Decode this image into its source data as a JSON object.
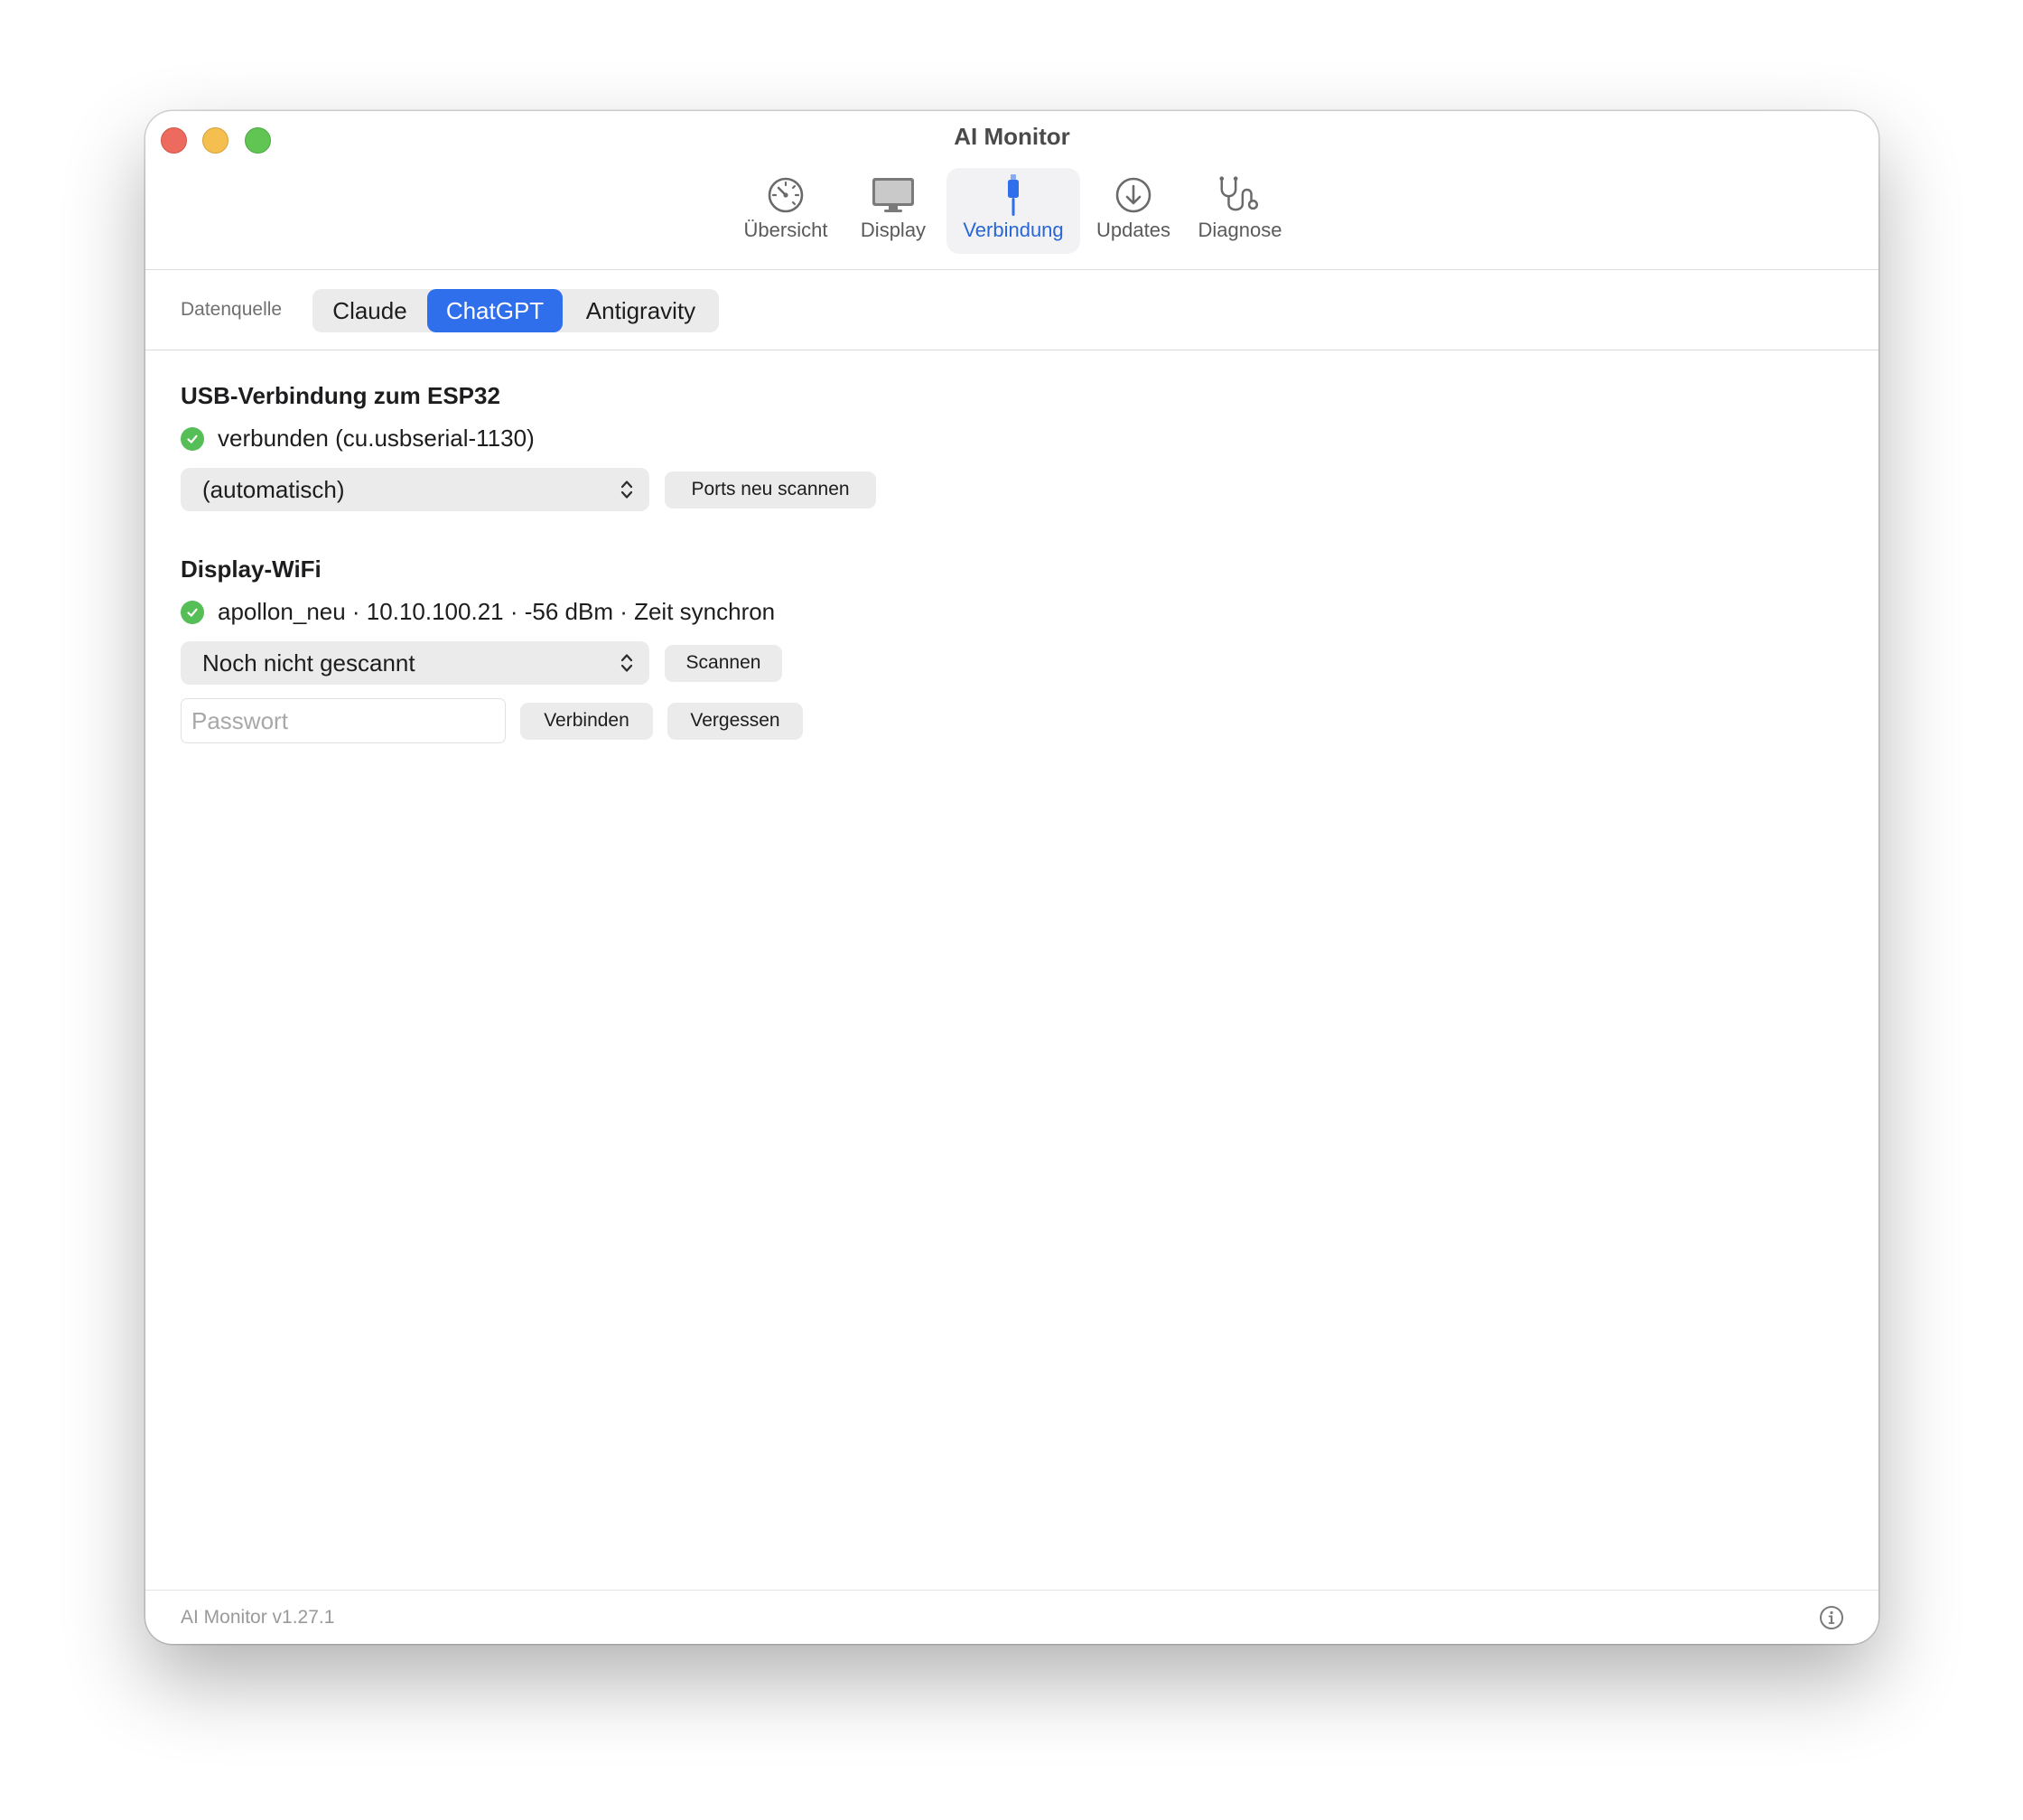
{
  "window": {
    "title": "AI Monitor"
  },
  "toolbar": {
    "items": [
      {
        "label": "Übersicht",
        "icon": "speedometer-icon"
      },
      {
        "label": "Display",
        "icon": "display-icon"
      },
      {
        "label": "Verbindung",
        "icon": "cable-connector-icon",
        "active": true
      },
      {
        "label": "Updates",
        "icon": "download-circle-icon"
      },
      {
        "label": "Diagnose",
        "icon": "stethoscope-icon"
      }
    ]
  },
  "source": {
    "label": "Datenquelle",
    "options": [
      "Claude",
      "ChatGPT",
      "Antigravity"
    ],
    "selected": "ChatGPT"
  },
  "usb": {
    "title": "USB-Verbindung zum ESP32",
    "status": "verbunden (cu.usbserial-1130)",
    "port_value": "(automatisch)",
    "rescan_label": "Ports neu scannen"
  },
  "wifi": {
    "title": "Display-WiFi",
    "status": "apollon_neu · 10.10.100.21 · -56 dBm · Zeit synchron",
    "network_value": "Noch nicht gescannt",
    "scan_label": "Scannen",
    "password_placeholder": "Passwort",
    "connect_label": "Verbinden",
    "forget_label": "Vergessen"
  },
  "footer": {
    "version": "AI Monitor v1.27.1",
    "info_icon": "info-circle-icon"
  },
  "colors": {
    "accent": "#2f6fec",
    "status_ok": "#55be57",
    "active_tab_text": "#2866d4"
  }
}
